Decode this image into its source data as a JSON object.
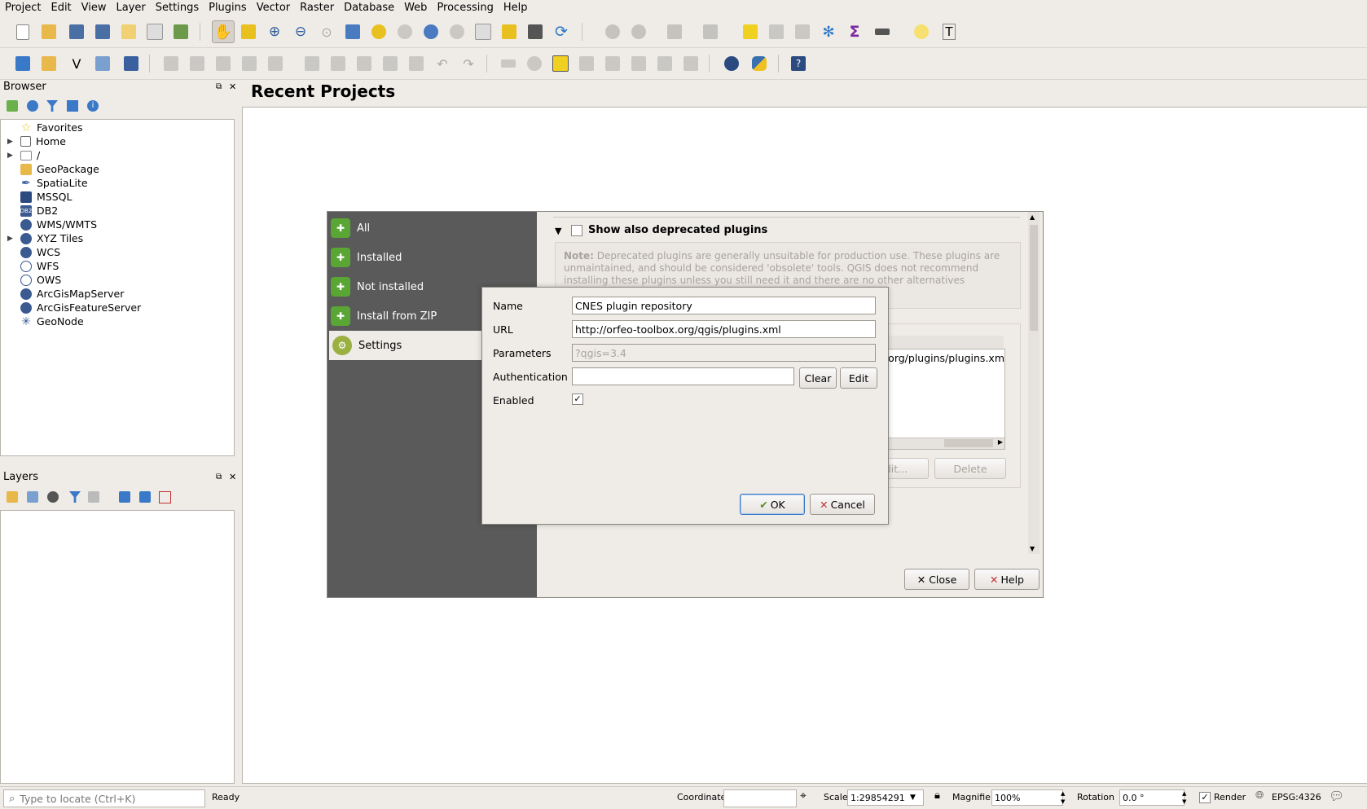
{
  "menu": [
    "Project",
    "Edit",
    "View",
    "Layer",
    "Settings",
    "Plugins",
    "Vector",
    "Raster",
    "Database",
    "Web",
    "Processing",
    "Help"
  ],
  "browser": {
    "title": "Browser",
    "items": [
      {
        "label": "Favorites",
        "icon": "star-icon",
        "expandable": false
      },
      {
        "label": "Home",
        "icon": "home-folder-icon",
        "expandable": true
      },
      {
        "label": "/",
        "icon": "folder-icon",
        "expandable": true
      },
      {
        "label": "GeoPackage",
        "icon": "geopackage-icon",
        "expandable": false
      },
      {
        "label": "SpatiaLite",
        "icon": "spatialite-icon",
        "expandable": false
      },
      {
        "label": "MSSQL",
        "icon": "mssql-icon",
        "expandable": false
      },
      {
        "label": "DB2",
        "icon": "db2-icon",
        "expandable": false
      },
      {
        "label": "WMS/WMTS",
        "icon": "globe-icon",
        "expandable": false
      },
      {
        "label": "XYZ Tiles",
        "icon": "globe-icon",
        "expandable": true
      },
      {
        "label": "WCS",
        "icon": "globe-icon",
        "expandable": false
      },
      {
        "label": "WFS",
        "icon": "globe-icon",
        "expandable": false
      },
      {
        "label": "OWS",
        "icon": "globe-icon",
        "expandable": false
      },
      {
        "label": "ArcGisMapServer",
        "icon": "globe-icon",
        "expandable": false
      },
      {
        "label": "ArcGisFeatureServer",
        "icon": "globe-icon",
        "expandable": false
      },
      {
        "label": "GeoNode",
        "icon": "geonode-icon",
        "expandable": false
      }
    ]
  },
  "layers": {
    "title": "Layers"
  },
  "main": {
    "title": "Recent Projects"
  },
  "plugins_dialog": {
    "tabs": [
      {
        "label": "All",
        "selected": false
      },
      {
        "label": "Installed",
        "selected": false
      },
      {
        "label": "Not installed",
        "selected": false
      },
      {
        "label": "Install from ZIP",
        "selected": false
      },
      {
        "label": "Settings",
        "selected": true
      }
    ],
    "deprecated_label": "Show also deprecated plugins",
    "note_bold": "Note:",
    "note_text": "Deprecated plugins are generally unsuitable for production use. These plugins are unmaintained, and should be considered 'obsolete' tools. QGIS does not recommend installing these plugins unless you still need it and there are no other alternatives",
    "repo_url_partial": "s.org/plugins/plugins.xm",
    "edit_label": "Edit...",
    "delete_label": "Delete",
    "close_label": "Close",
    "help_label": "Help"
  },
  "repo_dialog": {
    "name_label": "Name",
    "name_value": "CNES plugin repository",
    "url_label": "URL",
    "url_value": "http://orfeo-toolbox.org/qgis/plugins.xml",
    "params_label": "Parameters",
    "params_placeholder": "?qgis=3.4",
    "auth_label": "Authentication",
    "clear_label": "Clear",
    "edit_label": "Edit",
    "enabled_label": "Enabled",
    "enabled": true,
    "ok_label": "OK",
    "cancel_label": "Cancel"
  },
  "statusbar": {
    "locate_placeholder": "Type to locate (Ctrl+K)",
    "status": "Ready",
    "coordinate_label": "Coordinate",
    "coordinate_value": "",
    "scale_label": "Scale",
    "scale_value": "1:29854291",
    "magnifier_label": "Magnifier",
    "magnifier_value": "100%",
    "rotation_label": "Rotation",
    "rotation_value": "0.0 °",
    "render_label": "Render",
    "crs": "EPSG:4326"
  }
}
